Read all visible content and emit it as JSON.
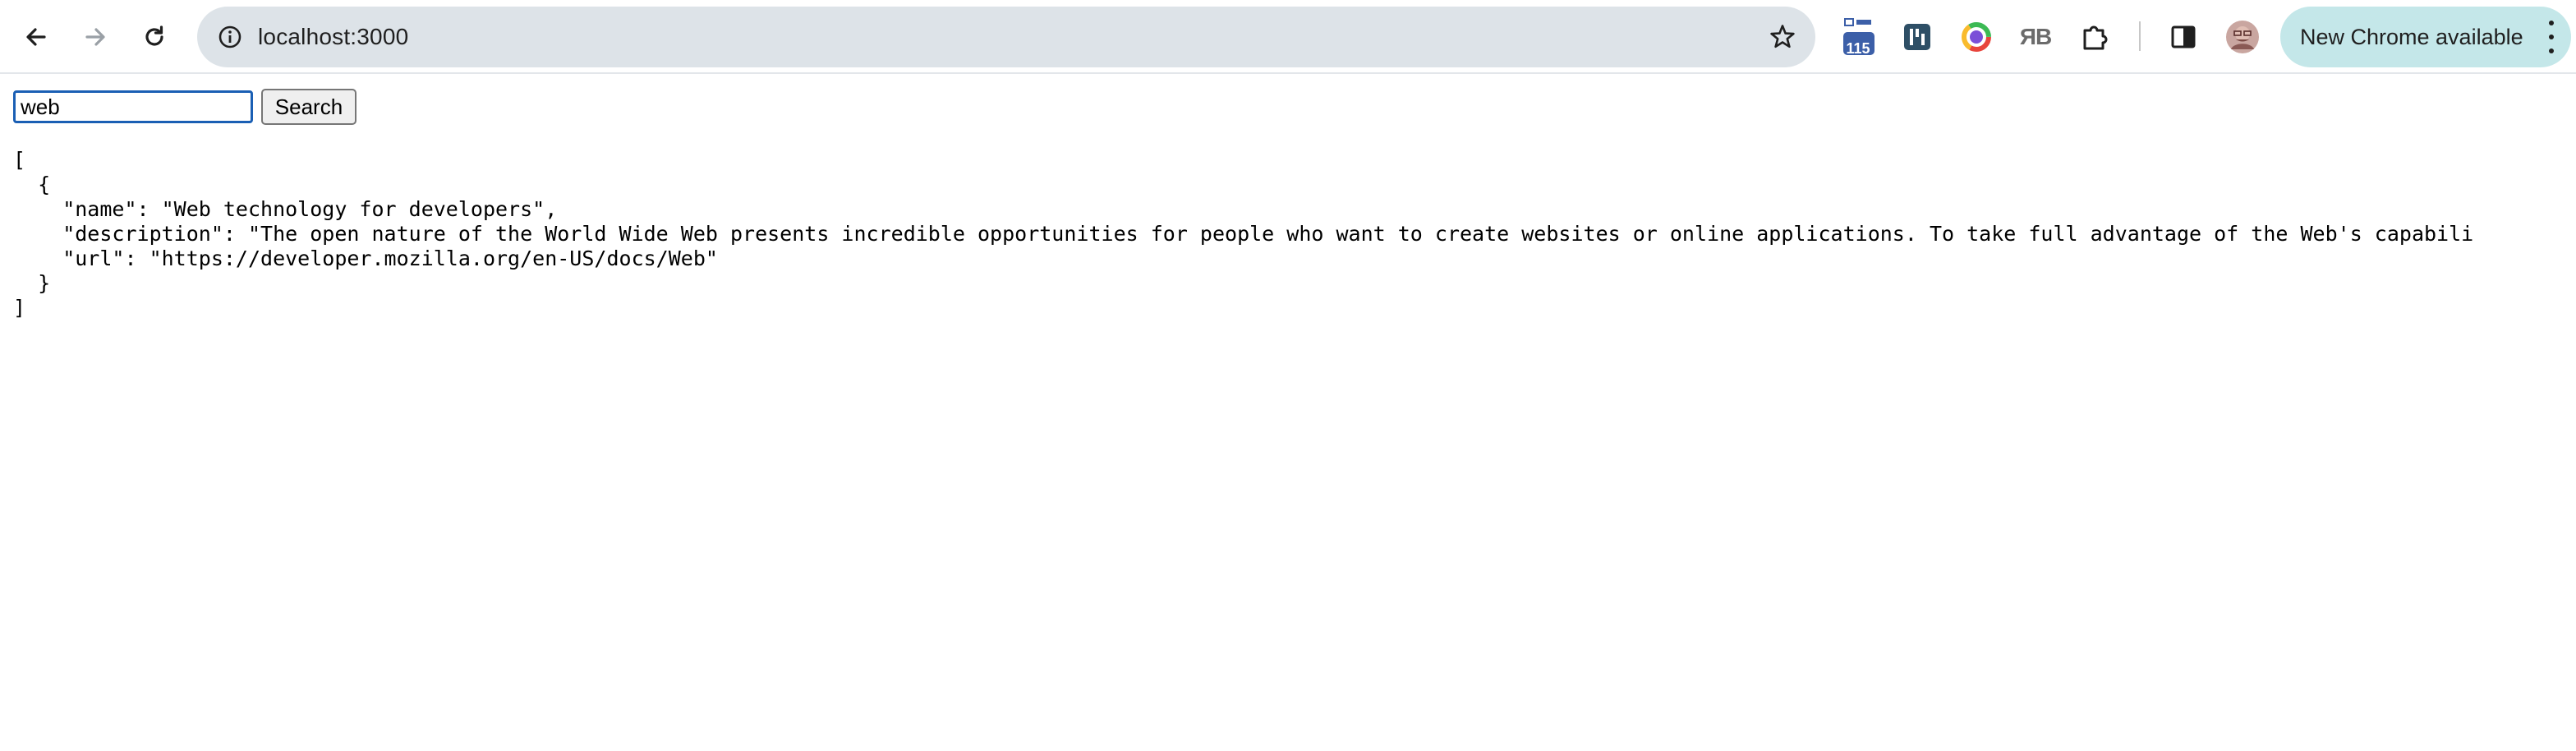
{
  "browser": {
    "url": "localhost:3000",
    "extensions": [
      {
        "name": "badge-extension-icon",
        "badge": "115"
      },
      {
        "name": "dashboard-extension-icon"
      },
      {
        "name": "color-circle-extension-icon"
      },
      {
        "name": "rb-extension-icon",
        "label": "ЯB"
      },
      {
        "name": "puzzle-extensions-icon"
      }
    ],
    "update_label": "New Chrome available"
  },
  "search": {
    "value": "web",
    "button_label": "Search"
  },
  "results": [
    {
      "name": "Web technology for developers",
      "description": "The open nature of the World Wide Web presents incredible opportunities for people who want to create websites or online applications. To take full advantage of the Web's capabili",
      "url": "https://developer.mozilla.org/en-US/docs/Web"
    }
  ],
  "colors": {
    "omnibox_bg": "#dde3e8",
    "update_pill_bg": "#c4e7e9",
    "input_focus_border": "#1a5fb4"
  }
}
